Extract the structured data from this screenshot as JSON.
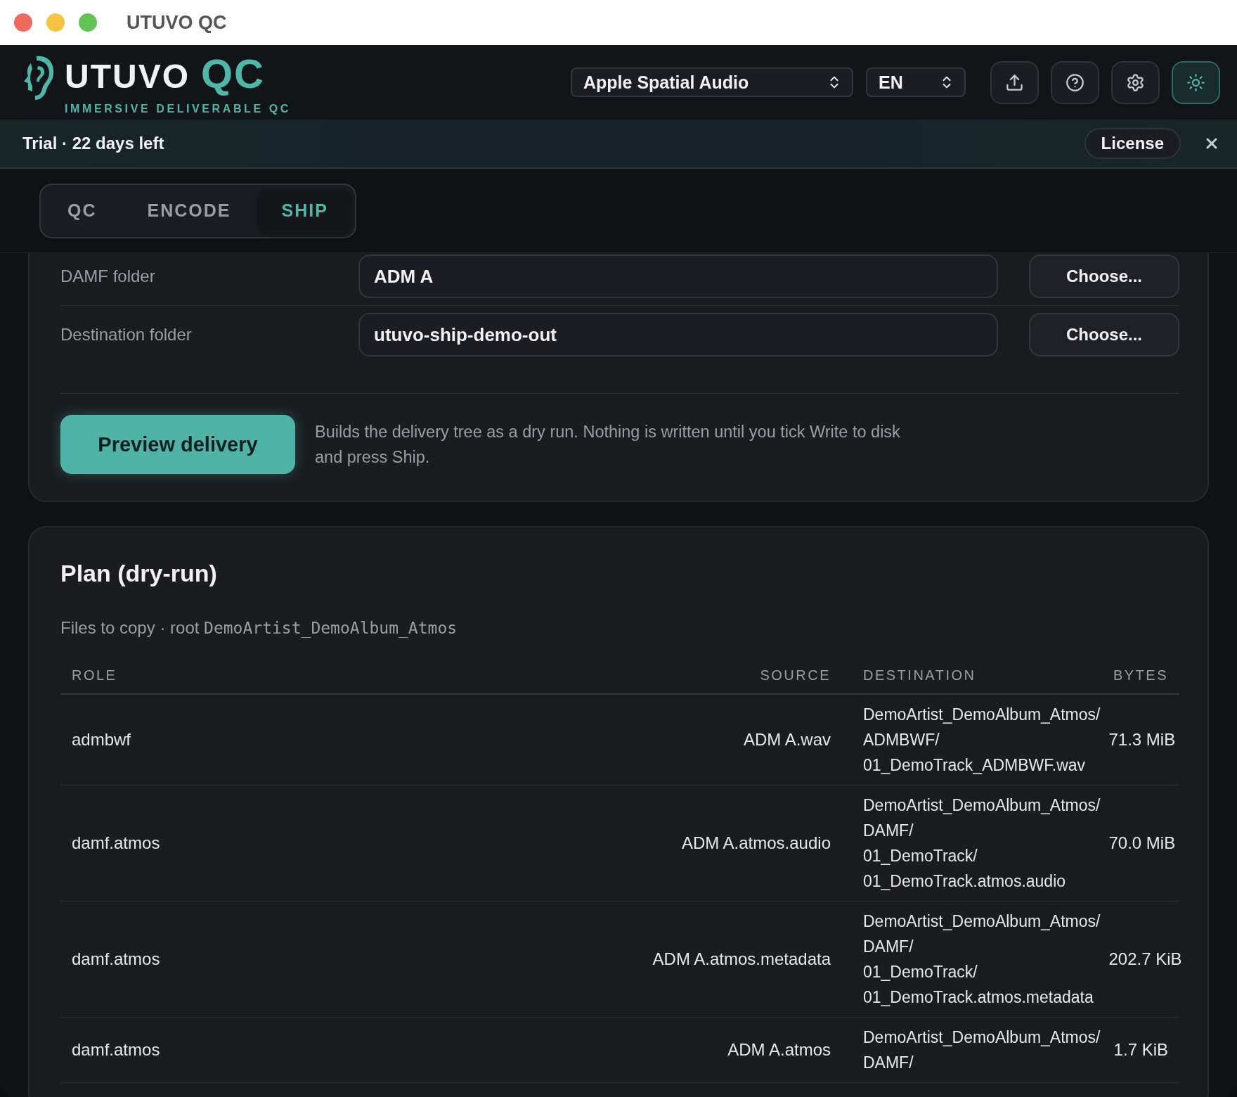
{
  "window": {
    "title": "UTUVO QC"
  },
  "header": {
    "logo": {
      "wordmark": "UTUVO",
      "accent": "QC",
      "tagline": "IMMERSIVE DELIVERABLE QC"
    },
    "profile_select": {
      "value": "Apple Spatial Audio"
    },
    "language_select": {
      "value": "EN"
    },
    "toolbar_buttons": [
      {
        "kind": "export",
        "selected": false
      },
      {
        "kind": "help",
        "selected": false
      },
      {
        "kind": "settings",
        "selected": false
      },
      {
        "kind": "theme",
        "selected": true
      }
    ]
  },
  "trial_banner": {
    "text": "Trial · 22 days left",
    "button": "License"
  },
  "tabs": [
    {
      "label": "QC",
      "selected": false
    },
    {
      "label": "ENCODE",
      "selected": false
    },
    {
      "label": "SHIP",
      "selected": true
    }
  ],
  "folders": [
    {
      "label": "DAMF folder",
      "value": "ADM A",
      "button": "Choose..."
    },
    {
      "label": "Destination folder",
      "value": "utuvo-ship-demo-out",
      "button": "Choose..."
    }
  ],
  "preview": {
    "button": "Preview delivery",
    "note": "Builds the delivery tree as a dry run. Nothing is written until you tick Write to disk and press Ship."
  },
  "plan": {
    "title": "Plan (dry-run)",
    "caption": "Files to copy · root",
    "root": "DemoArtist_DemoAlbum_Atmos",
    "table": {
      "columns": [
        "ROLE",
        "SOURCE",
        "DESTINATION",
        "BYTES"
      ],
      "rows": [
        {
          "role": "admbwf",
          "source": "ADM A.wav",
          "destination": [
            "DemoArtist_DemoAlbum_Atmos/",
            "ADMBWF/",
            "01_DemoTrack_ADMBWF.wav"
          ],
          "bytes": "71.3 MiB"
        },
        {
          "role": "damf.atmos",
          "source": "ADM A.atmos.audio",
          "destination": [
            "DemoArtist_DemoAlbum_Atmos/",
            "DAMF/",
            "01_DemoTrack/",
            "01_DemoTrack.atmos.audio"
          ],
          "bytes": "70.0 MiB"
        },
        {
          "role": "damf.atmos",
          "source": "ADM A.atmos.metadata",
          "destination": [
            "DemoArtist_DemoAlbum_Atmos/",
            "DAMF/",
            "01_DemoTrack/",
            "01_DemoTrack.atmos.metadata"
          ],
          "bytes": "202.7 KiB"
        },
        {
          "role": "damf.atmos",
          "source": "ADM A.atmos",
          "destination": [
            "DemoArtist_DemoAlbum_Atmos/",
            "DAMF/"
          ],
          "bytes": "1.7 KiB"
        }
      ]
    }
  }
}
